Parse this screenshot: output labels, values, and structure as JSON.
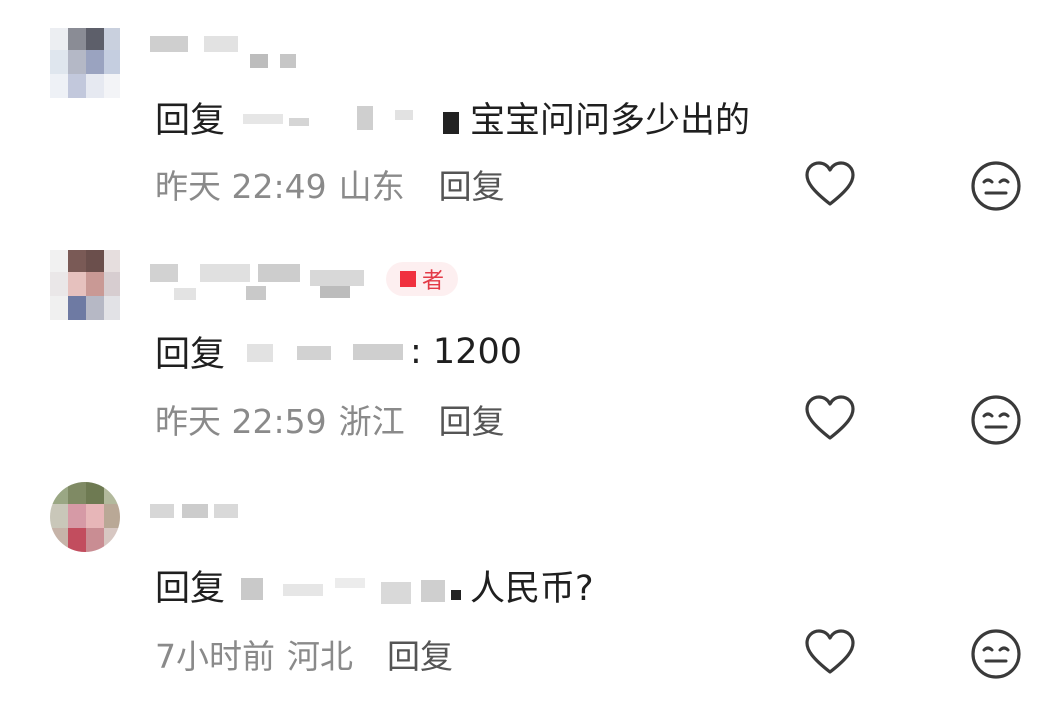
{
  "comments": [
    {
      "reply_prefix": "回复",
      "text": "宝宝问问多少出的",
      "time": "昨天 22:49",
      "location": "山东",
      "reply_button": "回复",
      "has_badge": false
    },
    {
      "reply_prefix": "回复",
      "text": ": 1200",
      "time": "昨天 22:59",
      "location": "浙江",
      "reply_button": "回复",
      "has_badge": true,
      "badge_text": "者"
    },
    {
      "reply_prefix": "回复",
      "text": "人民币?",
      "time": "7小时前",
      "location": "河北",
      "reply_button": "回复",
      "has_badge": false
    }
  ],
  "icons": {
    "like": "heart-outline-icon",
    "dislike": "meh-face-icon"
  },
  "colors": {
    "meta_text": "#8a8a8a",
    "badge_bg": "#fdeff0",
    "badge_accent": "#f0313f",
    "icon_stroke": "#3a3a3a"
  }
}
